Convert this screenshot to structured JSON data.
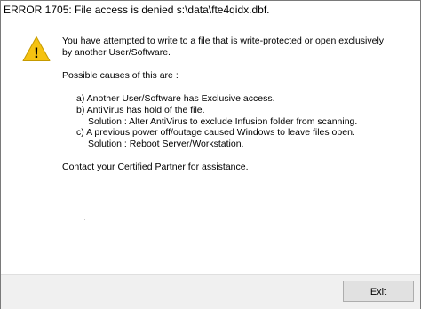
{
  "window": {
    "title": "ERROR 1705: File access is denied s:\\data\\fte4qidx.dbf."
  },
  "icon": {
    "name": "warning-icon",
    "fill_color": "#f5c211",
    "mark": "!"
  },
  "message": {
    "intro_line_1": "You have attempted to write to a file that is write-protected or open exclusively",
    "intro_line_2": "by another User/Software.",
    "causes_heading": "Possible causes of this are :",
    "cause_a": "a) Another User/Software has Exclusive access.",
    "cause_b": "b) AntiVirus has hold of the file.",
    "cause_b_solution": "Solution : Alter AntiVirus to exclude Infusion folder from scanning.",
    "cause_c": "c) A previous power off/outage caused Windows to leave files open.",
    "cause_c_solution": "Solution : Reboot Server/Workstation.",
    "contact": "Contact your Certified Partner for assistance."
  },
  "footer": {
    "exit_label": "Exit"
  }
}
